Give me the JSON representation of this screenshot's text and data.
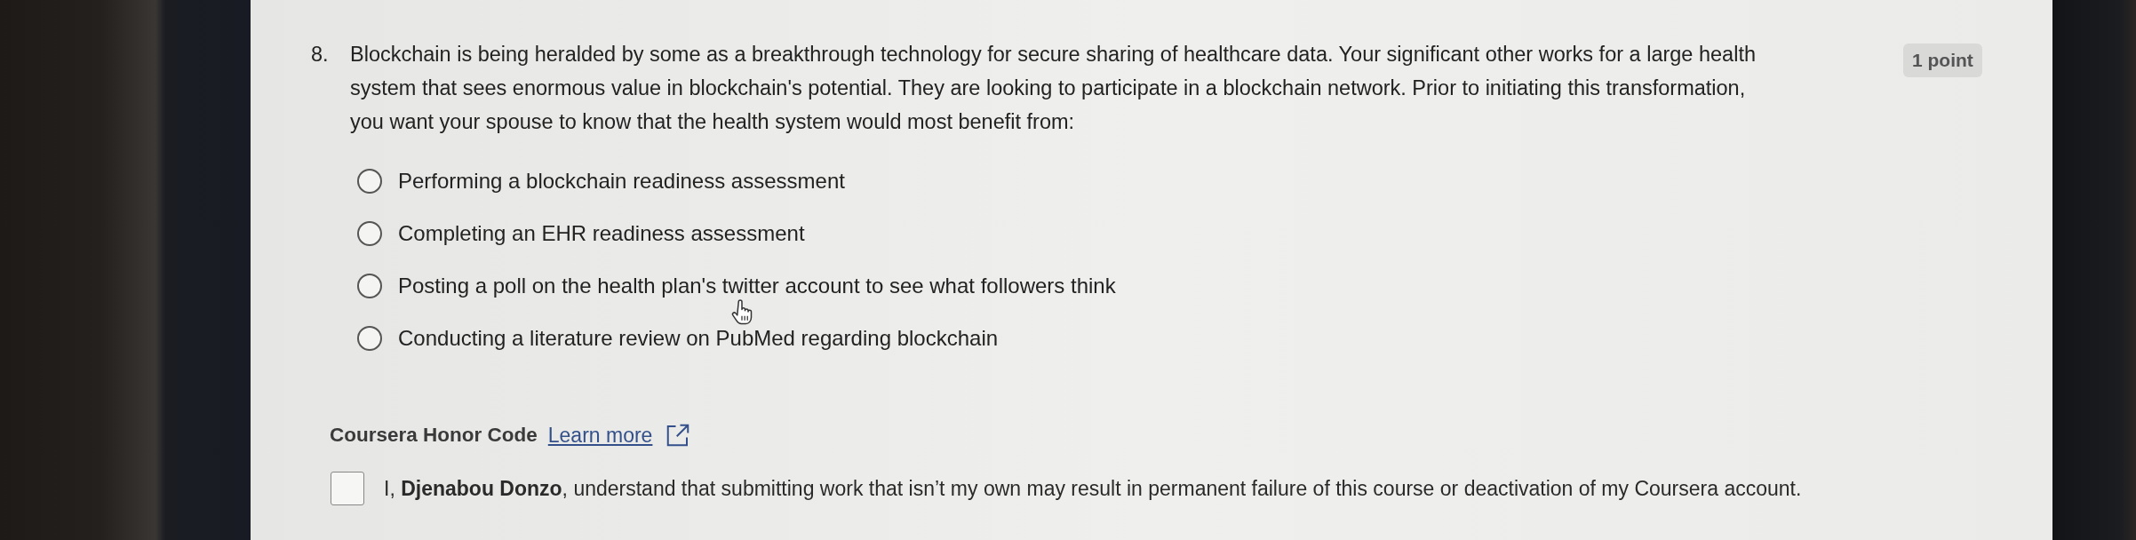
{
  "question": {
    "number": "8.",
    "text": "Blockchain is being heralded by some as a breakthrough technology for secure sharing of healthcare data. Your significant other works for a large health system that sees enormous value in blockchain's potential. They are looking to participate in a blockchain network. Prior to initiating this transformation, you want your spouse to know that the health system would most benefit from:",
    "points": "1 point",
    "options": [
      {
        "label": "Performing a blockchain readiness assessment",
        "selected": false
      },
      {
        "label": "Completing an EHR readiness assessment",
        "selected": false
      },
      {
        "label": "Posting a poll on the health plan's twitter account to see what followers think",
        "selected": false
      },
      {
        "label": "Conducting a literature review on PubMed regarding blockchain",
        "selected": false
      }
    ]
  },
  "honor_code": {
    "title": "Coursera Honor Code",
    "link": "Learn more",
    "agreement": "I, **Djenabou Donzo**, understand that submitting work that isn’t my own may result in permanent failure of this course or deactivation of my Coursera account.",
    "checked": false
  }
}
